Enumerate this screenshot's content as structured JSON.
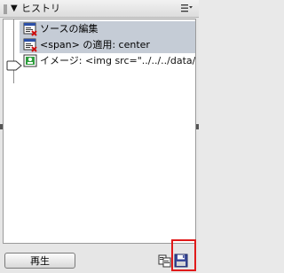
{
  "panel": {
    "title": "ヒストリ",
    "collapse_glyph": "▼"
  },
  "history": {
    "items": [
      {
        "label": "ソースの編集",
        "icon": "source-edit-icon"
      },
      {
        "label": "<span> の適用: center",
        "icon": "apply-tag-icon"
      },
      {
        "label": "イメージ: <img src=\"../../../data/",
        "icon": "image-icon"
      }
    ]
  },
  "footer": {
    "replay_label": "再生"
  },
  "colors": {
    "selection": "#c5ccd6",
    "highlight": "#e01a1a"
  }
}
